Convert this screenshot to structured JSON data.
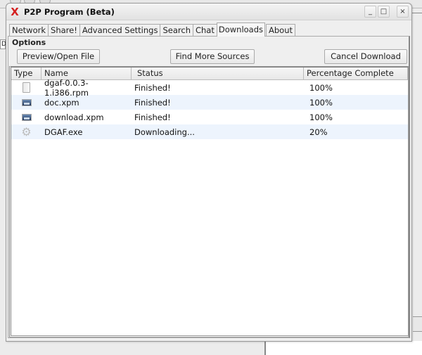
{
  "window": {
    "title": "P2P Program (Beta)",
    "app_icon": "x-logo-icon",
    "controls": {
      "minimize": "_",
      "maximize": "□",
      "close": "×"
    }
  },
  "tabs": [
    {
      "label": "Network",
      "active": false
    },
    {
      "label": "Share!",
      "active": false
    },
    {
      "label": "Advanced Settings",
      "active": false
    },
    {
      "label": "Search",
      "active": false
    },
    {
      "label": "Chat",
      "active": false
    },
    {
      "label": "Downloads",
      "active": true
    },
    {
      "label": "About",
      "active": false
    }
  ],
  "options": {
    "label": "Options",
    "preview_button": "Preview/Open File",
    "find_sources_button": "Find More Sources",
    "cancel_button": "Cancel Download"
  },
  "table": {
    "columns": [
      "Type",
      "Name",
      "Status",
      "Percentage Complete"
    ],
    "rows": [
      {
        "type_icon": "document-icon",
        "name": "dgaf-0.0.3-1.i386.rpm",
        "status": "Finished!",
        "percent": "100%"
      },
      {
        "type_icon": "image-icon",
        "name": "doc.xpm",
        "status": "Finished!",
        "percent": "100%"
      },
      {
        "type_icon": "image-icon",
        "name": "download.xpm",
        "status": "Finished!",
        "percent": "100%"
      },
      {
        "type_icon": "executable-gear-icon",
        "name": "DGAF.exe",
        "status": "Downloading...",
        "percent": "20%"
      }
    ]
  },
  "background": {
    "left_fragment": "D"
  }
}
